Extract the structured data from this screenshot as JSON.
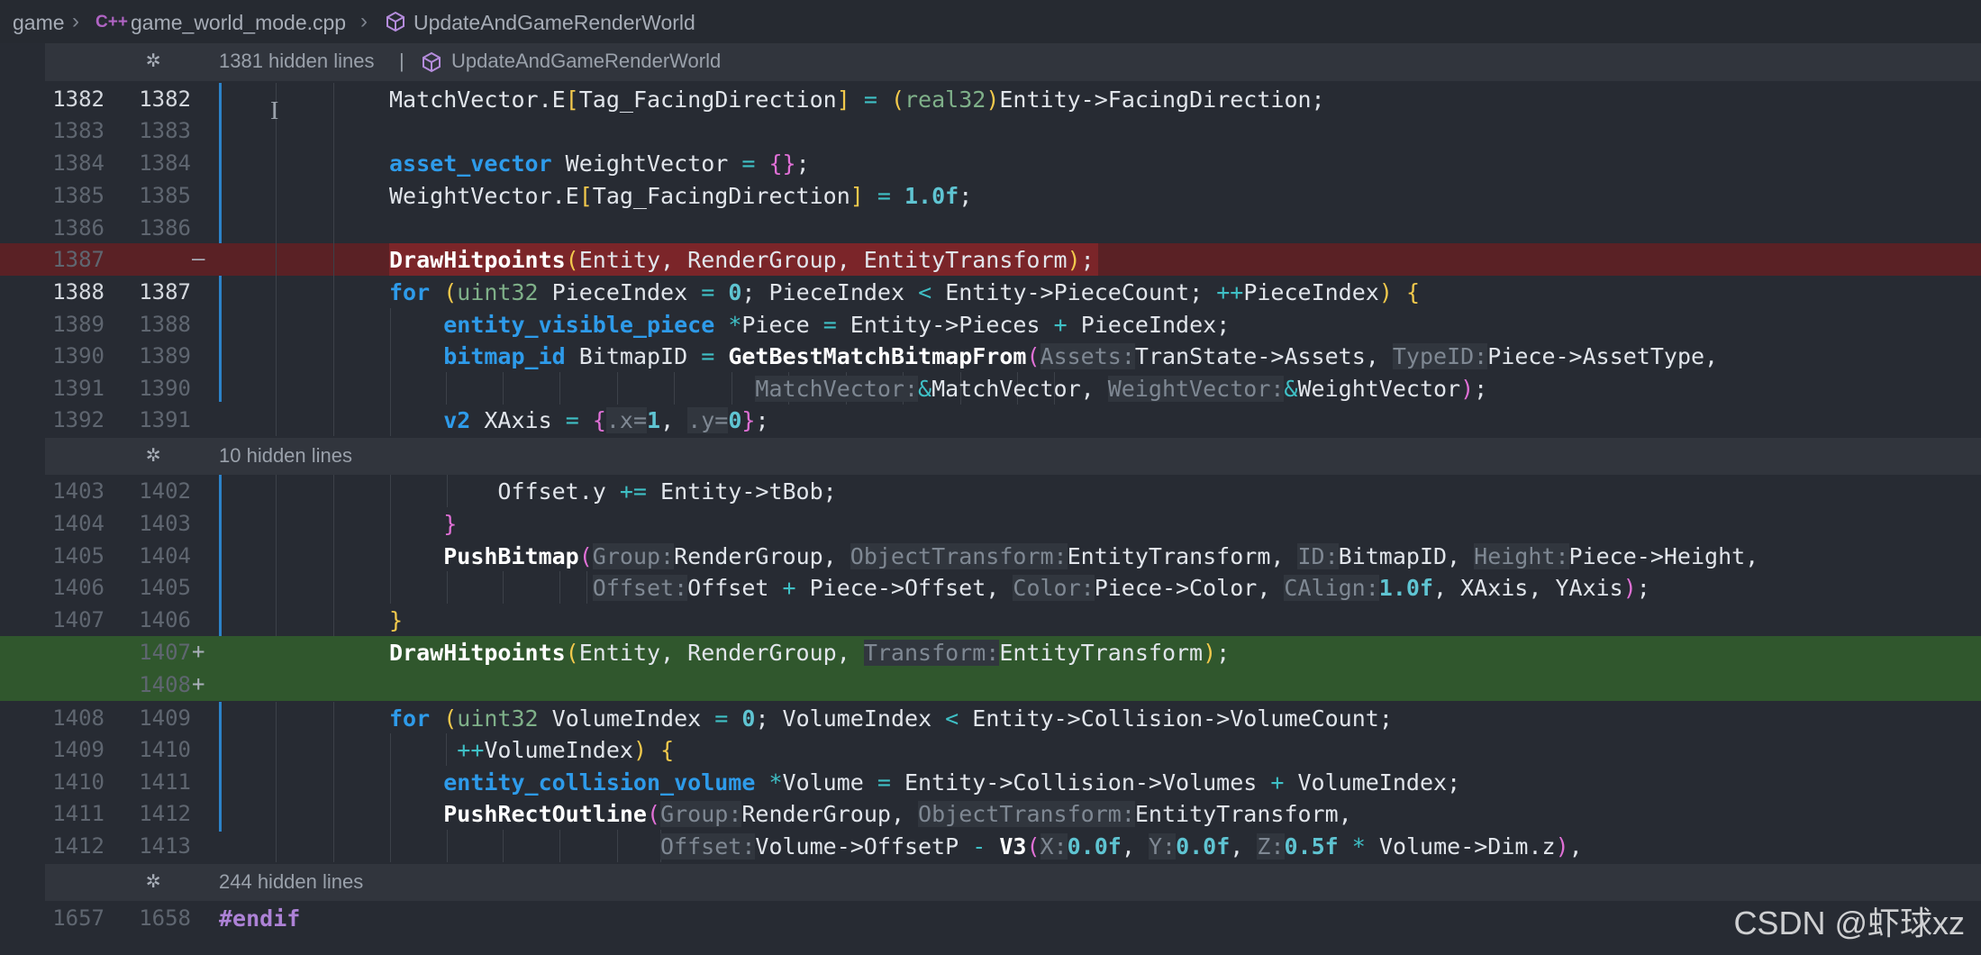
{
  "breadcrumb": {
    "folder": "game",
    "file_icon": "C++",
    "file": "game_world_mode.cpp",
    "symbol_icon": "cube-icon",
    "symbol": "UpdateAndGameRenderWorld"
  },
  "fold_icon": "asterisk-unfold-icon",
  "folds": [
    {
      "label": "1381 hidden lines",
      "separator": "|",
      "symbol": "UpdateAndGameRenderWorld"
    },
    {
      "label": "10 hidden lines"
    },
    {
      "label": "244 hidden lines"
    }
  ],
  "lines": [
    {
      "old": "1382",
      "new": "1382",
      "marker": "",
      "state": "normal"
    },
    {
      "old": "1383",
      "new": "1383",
      "marker": "",
      "state": "normal"
    },
    {
      "old": "1384",
      "new": "1384",
      "marker": "",
      "state": "normal"
    },
    {
      "old": "1385",
      "new": "1385",
      "marker": "",
      "state": "normal"
    },
    {
      "old": "1386",
      "new": "1386",
      "marker": "",
      "state": "normal"
    },
    {
      "old": "1387",
      "new": "",
      "marker": "—",
      "state": "deleted"
    },
    {
      "old": "1388",
      "new": "1387",
      "marker": "",
      "state": "normal"
    },
    {
      "old": "1389",
      "new": "1388",
      "marker": "",
      "state": "normal"
    },
    {
      "old": "1390",
      "new": "1389",
      "marker": "",
      "state": "normal"
    },
    {
      "old": "1391",
      "new": "1390",
      "marker": "",
      "state": "normal"
    },
    {
      "old": "1392",
      "new": "1391",
      "marker": "",
      "state": "normal"
    },
    {
      "old": "1403",
      "new": "1402",
      "marker": "",
      "state": "normal"
    },
    {
      "old": "1404",
      "new": "1403",
      "marker": "",
      "state": "normal"
    },
    {
      "old": "1405",
      "new": "1404",
      "marker": "",
      "state": "normal"
    },
    {
      "old": "1406",
      "new": "1405",
      "marker": "",
      "state": "normal"
    },
    {
      "old": "1407",
      "new": "1406",
      "marker": "",
      "state": "normal"
    },
    {
      "old": "",
      "new": "1407",
      "marker": "+",
      "state": "added"
    },
    {
      "old": "",
      "new": "1408",
      "marker": "+",
      "state": "added"
    },
    {
      "old": "1408",
      "new": "1409",
      "marker": "",
      "state": "normal"
    },
    {
      "old": "1409",
      "new": "1410",
      "marker": "",
      "state": "normal"
    },
    {
      "old": "1410",
      "new": "1411",
      "marker": "",
      "state": "normal"
    },
    {
      "old": "1411",
      "new": "1412",
      "marker": "",
      "state": "normal"
    },
    {
      "old": "1412",
      "new": "1413",
      "marker": "",
      "state": "normal"
    },
    {
      "old": "1657",
      "new": "1658",
      "marker": "",
      "state": "normal"
    }
  ],
  "code": [
    [
      {
        "t": "MatchVector.E"
      },
      {
        "t": "[",
        "c": "p"
      },
      {
        "t": "Tag_FacingDirection"
      },
      {
        "t": "]",
        "c": "p"
      },
      {
        "t": " = ",
        "c": "o"
      },
      {
        "t": "(",
        "c": "p"
      },
      {
        "t": "real32",
        "c": "t"
      },
      {
        "t": ")",
        "c": "p"
      },
      {
        "t": "Entity->FacingDirection;"
      }
    ],
    [],
    [
      {
        "t": "asset_vector",
        "c": "k"
      },
      {
        "t": " WeightVector "
      },
      {
        "t": "=",
        "c": "o"
      },
      {
        "t": " "
      },
      {
        "t": "{}",
        "c": "pk"
      },
      {
        "t": ";"
      }
    ],
    [
      {
        "t": "WeightVector.E"
      },
      {
        "t": "[",
        "c": "p"
      },
      {
        "t": "Tag_FacingDirection"
      },
      {
        "t": "]",
        "c": "p"
      },
      {
        "t": " = ",
        "c": "o"
      },
      {
        "t": "1.0f",
        "c": "n"
      },
      {
        "t": ";"
      }
    ],
    [],
    [
      {
        "t": "DrawHitpoints",
        "c": "f"
      },
      {
        "t": "(",
        "c": "p"
      },
      {
        "t": "Entity, RenderGroup, EntityTransform"
      },
      {
        "t": ")",
        "c": "p"
      },
      {
        "t": ";"
      }
    ],
    [
      {
        "t": "for",
        "c": "k"
      },
      {
        "t": " "
      },
      {
        "t": "(",
        "c": "p"
      },
      {
        "t": "uint32",
        "c": "t"
      },
      {
        "t": " PieceIndex "
      },
      {
        "t": "=",
        "c": "o"
      },
      {
        "t": " "
      },
      {
        "t": "0",
        "c": "n"
      },
      {
        "t": "; PieceIndex "
      },
      {
        "t": "<",
        "c": "o"
      },
      {
        "t": " Entity->PieceCount; "
      },
      {
        "t": "++",
        "c": "o"
      },
      {
        "t": "PieceIndex"
      },
      {
        "t": ")",
        "c": "p"
      },
      {
        "t": " "
      },
      {
        "t": "{",
        "c": "p"
      }
    ],
    [
      {
        "t": "    "
      },
      {
        "t": "entity_visible_piece",
        "c": "k"
      },
      {
        "t": " "
      },
      {
        "t": "*",
        "c": "o"
      },
      {
        "t": "Piece "
      },
      {
        "t": "=",
        "c": "o"
      },
      {
        "t": " Entity->Pieces "
      },
      {
        "t": "+",
        "c": "o"
      },
      {
        "t": " PieceIndex;"
      }
    ],
    [
      {
        "t": "    "
      },
      {
        "t": "bitmap_id",
        "c": "k"
      },
      {
        "t": " BitmapID "
      },
      {
        "t": "=",
        "c": "o"
      },
      {
        "t": " "
      },
      {
        "t": "GetBestMatchBitmapFrom",
        "c": "f"
      },
      {
        "t": "(",
        "c": "pk"
      },
      {
        "t": "Assets:",
        "c": "hn"
      },
      {
        "t": "TranState->Assets, "
      },
      {
        "t": "TypeID:",
        "c": "hn"
      },
      {
        "t": "Piece->AssetType,"
      }
    ],
    [
      {
        "t": "                           "
      },
      {
        "t": "MatchVector:",
        "c": "hn"
      },
      {
        "t": "&",
        "c": "o"
      },
      {
        "t": "MatchVector, "
      },
      {
        "t": "WeightVector:",
        "c": "hn"
      },
      {
        "t": "&",
        "c": "o"
      },
      {
        "t": "WeightVector"
      },
      {
        "t": ")",
        "c": "pk"
      },
      {
        "t": ";"
      }
    ],
    [
      {
        "t": "    "
      },
      {
        "t": "v2",
        "c": "k"
      },
      {
        "t": " XAxis "
      },
      {
        "t": "=",
        "c": "o"
      },
      {
        "t": " "
      },
      {
        "t": "{",
        "c": "pk"
      },
      {
        "t": ".x=",
        "c": "hn"
      },
      {
        "t": "1",
        "c": "n"
      },
      {
        "t": ", "
      },
      {
        "t": ".y=",
        "c": "hn"
      },
      {
        "t": "0",
        "c": "n"
      },
      {
        "t": "}",
        "c": "pk"
      },
      {
        "t": ";"
      }
    ],
    [
      {
        "t": "        Offset.y "
      },
      {
        "t": "+=",
        "c": "o"
      },
      {
        "t": " Entity->tBob;"
      }
    ],
    [
      {
        "t": "    "
      },
      {
        "t": "}",
        "c": "pk"
      }
    ],
    [
      {
        "t": "    "
      },
      {
        "t": "PushBitmap",
        "c": "f"
      },
      {
        "t": "(",
        "c": "pk"
      },
      {
        "t": "Group:",
        "c": "hn"
      },
      {
        "t": "RenderGroup, "
      },
      {
        "t": "ObjectTransform:",
        "c": "hn"
      },
      {
        "t": "EntityTransform, "
      },
      {
        "t": "ID:",
        "c": "hn"
      },
      {
        "t": "BitmapID, "
      },
      {
        "t": "Height:",
        "c": "hn"
      },
      {
        "t": "Piece->Height,"
      }
    ],
    [
      {
        "t": "               "
      },
      {
        "t": "Offset:",
        "c": "hn"
      },
      {
        "t": "Offset "
      },
      {
        "t": "+",
        "c": "o"
      },
      {
        "t": " Piece->Offset, "
      },
      {
        "t": "Color:",
        "c": "hn"
      },
      {
        "t": "Piece->Color, "
      },
      {
        "t": "CAlign:",
        "c": "hn"
      },
      {
        "t": "1.0f",
        "c": "n"
      },
      {
        "t": ", XAxis, YAxis"
      },
      {
        "t": ")",
        "c": "pk"
      },
      {
        "t": ";"
      }
    ],
    [
      {
        "t": "}",
        "c": "p"
      }
    ],
    [
      {
        "t": "DrawHitpoints",
        "c": "f"
      },
      {
        "t": "(",
        "c": "p"
      },
      {
        "t": "Entity, RenderGroup, "
      },
      {
        "t": "Transform:",
        "c": "hn"
      },
      {
        "t": "EntityTransform"
      },
      {
        "t": ")",
        "c": "p"
      },
      {
        "t": ";"
      }
    ],
    [],
    [
      {
        "t": "for",
        "c": "k"
      },
      {
        "t": " "
      },
      {
        "t": "(",
        "c": "p"
      },
      {
        "t": "uint32",
        "c": "t"
      },
      {
        "t": " VolumeIndex "
      },
      {
        "t": "=",
        "c": "o"
      },
      {
        "t": " "
      },
      {
        "t": "0",
        "c": "n"
      },
      {
        "t": "; VolumeIndex "
      },
      {
        "t": "<",
        "c": "o"
      },
      {
        "t": " Entity->Collision->VolumeCount;"
      }
    ],
    [
      {
        "t": "     "
      },
      {
        "t": "++",
        "c": "o"
      },
      {
        "t": "VolumeIndex"
      },
      {
        "t": ")",
        "c": "p"
      },
      {
        "t": " "
      },
      {
        "t": "{",
        "c": "p"
      }
    ],
    [
      {
        "t": "    "
      },
      {
        "t": "entity_collision_volume",
        "c": "k"
      },
      {
        "t": " "
      },
      {
        "t": "*",
        "c": "o"
      },
      {
        "t": "Volume "
      },
      {
        "t": "=",
        "c": "o"
      },
      {
        "t": " Entity->Collision->Volumes "
      },
      {
        "t": "+",
        "c": "o"
      },
      {
        "t": " VolumeIndex;"
      }
    ],
    [
      {
        "t": "    "
      },
      {
        "t": "PushRectOutline",
        "c": "f"
      },
      {
        "t": "(",
        "c": "pk"
      },
      {
        "t": "Group:",
        "c": "hn"
      },
      {
        "t": "RenderGroup, "
      },
      {
        "t": "ObjectTransform:",
        "c": "hn"
      },
      {
        "t": "EntityTransform,"
      }
    ],
    [
      {
        "t": "                    "
      },
      {
        "t": "Offset:",
        "c": "hn"
      },
      {
        "t": "Volume->OffsetP "
      },
      {
        "t": "-",
        "c": "o"
      },
      {
        "t": " "
      },
      {
        "t": "V3",
        "c": "f"
      },
      {
        "t": "(",
        "c": "pk"
      },
      {
        "t": "X:",
        "c": "hn"
      },
      {
        "t": "0.0f",
        "c": "n"
      },
      {
        "t": ", "
      },
      {
        "t": "Y:",
        "c": "hn"
      },
      {
        "t": "0.0f",
        "c": "n"
      },
      {
        "t": ", "
      },
      {
        "t": "Z:",
        "c": "hn"
      },
      {
        "t": "0.5f",
        "c": "n"
      },
      {
        "t": " "
      },
      {
        "t": "*",
        "c": "o"
      },
      {
        "t": " Volume->Dim.z"
      },
      {
        "t": ")",
        "c": "pk"
      },
      {
        "t": ","
      }
    ],
    [
      {
        "t": "#endif",
        "c": "mc"
      }
    ]
  ],
  "watermark": "CSDN @虾球xz"
}
